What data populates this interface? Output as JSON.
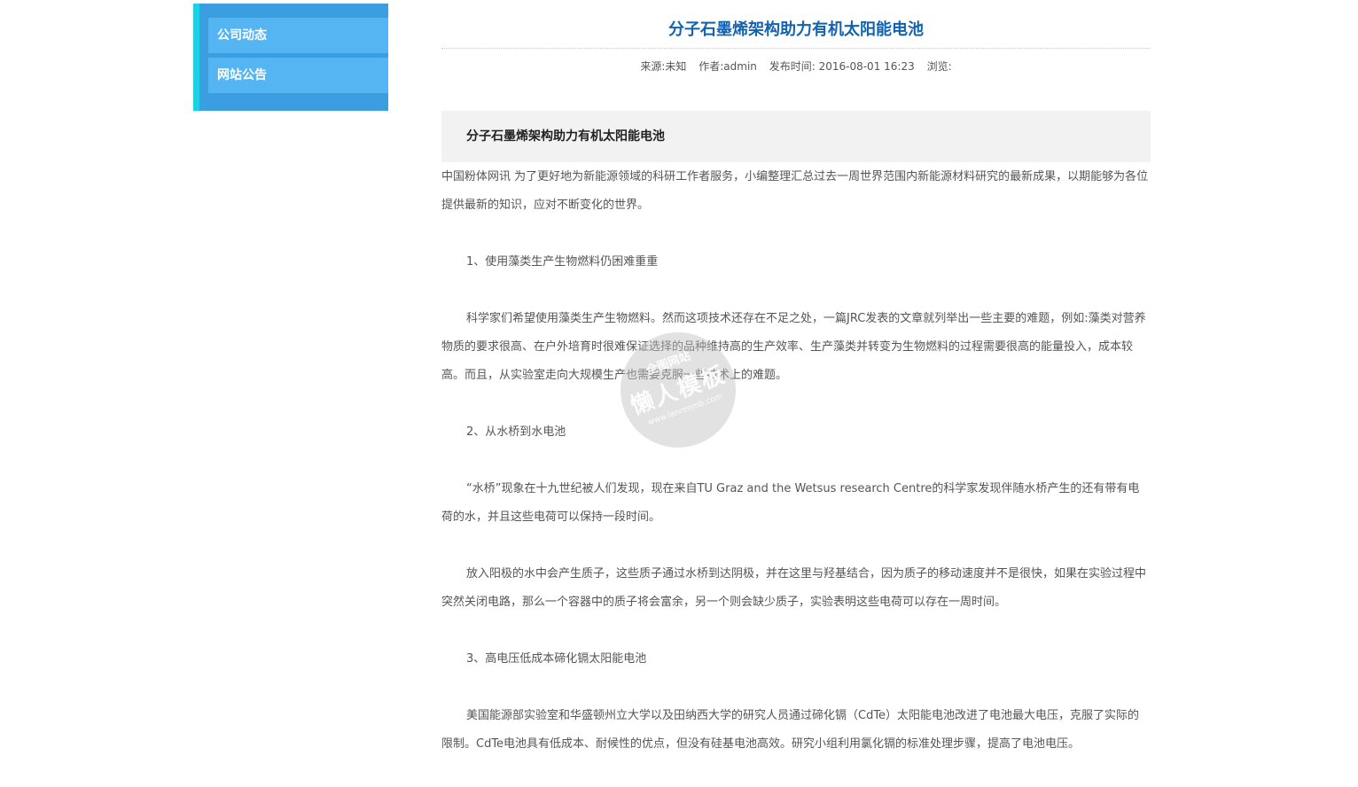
{
  "sidebar": {
    "items": [
      {
        "label": "公司动态"
      },
      {
        "label": "网站公告"
      }
    ]
  },
  "article": {
    "title": "分子石墨烯架构助力有机太阳能电池",
    "meta": {
      "source": "来源:未知",
      "author": "作者:admin",
      "published": "发布时间: 2016-08-01 16:23",
      "views": "浏览:"
    },
    "subhead": "分子石墨烯架构助力有机太阳能电池",
    "paragraphs": [
      "中国粉体网讯    为了更好地为新能源领域的科研工作者服务，小编整理汇总过去一周世界范围内新能源材料研究的最新成果，以期能够为各位提供最新的知识，应对不断变化的世界。",
      "1、使用藻类生产生物燃料仍困难重重",
      "科学家们希望使用藻类生产生物燃料。然而这项技术还存在不足之处，一篇JRC发表的文章就列举出一些主要的难题，例如:藻类对营养物质的要求很高、在户外培育时很难保证选择的品种维持高的生产效率、生产藻类并转变为生物燃料的过程需要很高的能量投入，成本较高。而且，从实验室走向大规模生产也需要克服一些技术上的难题。",
      "2、从水桥到水电池",
      "“水桥”现象在十九世纪被人们发现，现在来自TU Graz and the Wetsus research Centre的科学家发现伴随水桥产生的还有带有电荷的水，并且这些电荷可以保持一段时间。",
      "放入阳极的水中会产生质子，这些质子通过水桥到达阴极，并在这里与羟基结合，因为质子的移动速度并不是很快，如果在实验过程中突然关闭电路，那么一个容器中的质子将会富余，另一个则会缺少质子，实验表明这些电荷可以存在一周时间。",
      "3、高电压低成本碲化镉太阳能电池",
      "美国能源部实验室和华盛顿州立大学以及田纳西大学的研究人员通过碲化镉（CdTe）太阳能电池改进了电池最大电压，克服了实际的限制。CdTe电池具有低成本、耐候性的优点，但没有硅基电池高效。研究小组利用氯化镉的标准处理步骤，提高了电池电压。"
    ]
  },
  "watermark": {
    "top": "全图网站",
    "main": "懒人模板",
    "url": "www.lanrenmb.com"
  }
}
